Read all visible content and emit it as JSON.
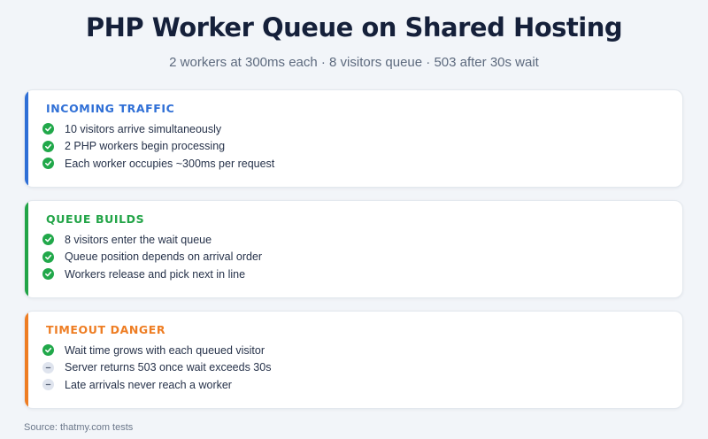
{
  "title": "PHP Worker Queue on Shared Hosting",
  "subtitle": "2 workers at 300ms each · 8 visitors queue · 503 after 30s wait",
  "colors": {
    "blue": "#2f6fd6",
    "green": "#22a447",
    "orange": "#ee7d23",
    "check": "#21a84a",
    "neutral": "#dfe4ee"
  },
  "cards": [
    {
      "heading": "INCOMING TRAFFIC",
      "accent": "#2f6fd6",
      "items": [
        {
          "text": "10 visitors arrive simultaneously",
          "icon": "check-icon"
        },
        {
          "text": "2 PHP workers begin processing",
          "icon": "check-icon"
        },
        {
          "text": "Each worker occupies ~300ms per request",
          "icon": "check-icon"
        }
      ]
    },
    {
      "heading": "QUEUE BUILDS",
      "accent": "#22a447",
      "items": [
        {
          "text": "8 visitors enter the wait queue",
          "icon": "check-icon"
        },
        {
          "text": "Queue position depends on arrival order",
          "icon": "check-icon"
        },
        {
          "text": "Workers release and pick next in line",
          "icon": "check-icon"
        }
      ]
    },
    {
      "heading": "TIMEOUT DANGER",
      "accent": "#ee7d23",
      "items": [
        {
          "text": "Wait time grows with each queued visitor",
          "icon": "check-icon"
        },
        {
          "text": "Server returns 503 once wait exceeds 30s",
          "icon": "minus-icon"
        },
        {
          "text": "Late arrivals never reach a worker",
          "icon": "minus-icon"
        }
      ]
    }
  ],
  "source": "Source: thatmy.com tests"
}
